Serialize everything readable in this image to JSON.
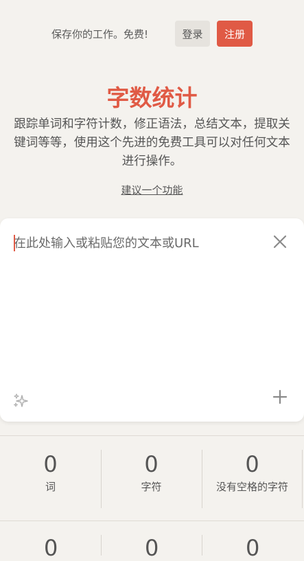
{
  "header": {
    "save_note": "保存你的工作。免费!",
    "login_label": "登录",
    "signup_label": "注册"
  },
  "hero": {
    "title": "字数统计",
    "subtitle": "跟踪单词和字符计数，修正语法，总结文本，提取关键词等等，使用这个先进的免费工具可以对任何文本进行操作。",
    "suggest_link": "建议一个功能"
  },
  "editor": {
    "placeholder": "在此处输入或粘贴您的文本或URL",
    "value": ""
  },
  "stats": [
    {
      "value": "0",
      "label": "词"
    },
    {
      "value": "0",
      "label": "字符"
    },
    {
      "value": "0",
      "label": "没有空格的字符"
    }
  ],
  "stats_row2": [
    "0",
    "0",
    "0"
  ],
  "colors": {
    "accent": "#e05a45",
    "background": "#f4f2ee"
  },
  "icons": {
    "clear": "close-icon",
    "ai": "sparkle-icon",
    "add": "plus-icon"
  }
}
